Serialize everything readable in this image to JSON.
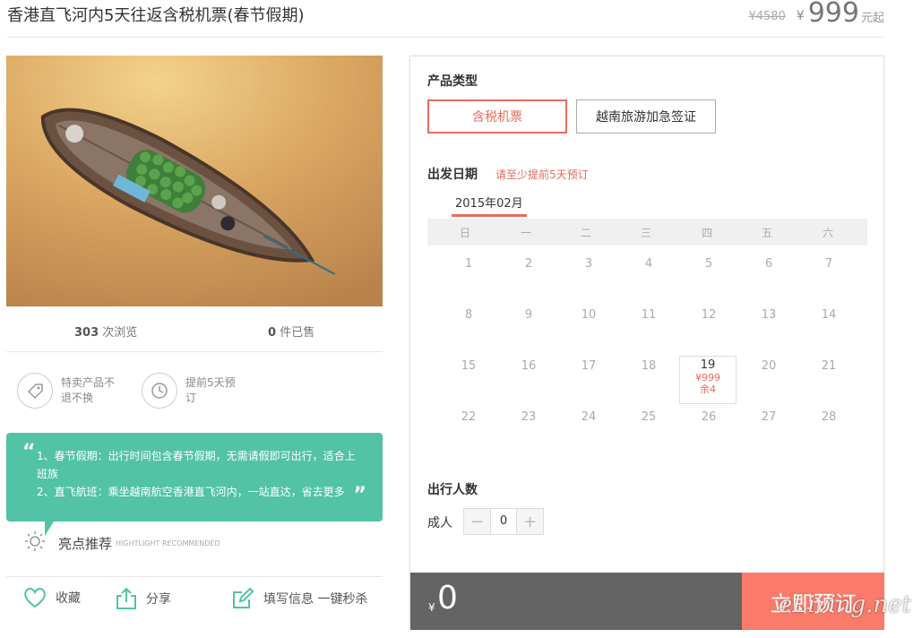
{
  "product": {
    "title": "香港直飞河内5天往返含税机票(春节假期)",
    "old_price": "¥4580",
    "currency": "¥",
    "price": "999",
    "price_unit": "元起"
  },
  "stats": {
    "views_count": "303",
    "views_label": "次浏览",
    "sold_count": "0",
    "sold_label": "件已售"
  },
  "features": [
    {
      "text": "特卖产品不退不换",
      "icon": "tag-icon"
    },
    {
      "text": "提前5天预订",
      "icon": "clock-icon"
    }
  ],
  "highlights": {
    "line1": "1、春节假期：出行时间包含春节假期，无需请假即可出行，适合上班族",
    "line2": "2、直飞航班：乘坐越南航空香港直飞河内，一站直达，省去更多",
    "title": "亮点推荐",
    "subtitle_en": "HIGHTLIGHT RECOMMENDED",
    "color": "#52c3a5"
  },
  "actions": {
    "favorite": "收藏",
    "share": "分享",
    "fill_info": "填写信息 一键秒杀"
  },
  "booking": {
    "product_type_label": "产品类型",
    "types": [
      "含税机票",
      "越南旅游加急签证"
    ],
    "date_label": "出发日期",
    "date_note": "请至少提前5天预订",
    "month": "2015年02月",
    "weekdays": [
      "日",
      "一",
      "二",
      "三",
      "四",
      "五",
      "六"
    ],
    "days": [
      "1",
      "2",
      "3",
      "4",
      "5",
      "6",
      "7",
      "8",
      "9",
      "10",
      "11",
      "12",
      "13",
      "14",
      "15",
      "16",
      "17",
      "18",
      "19",
      "20",
      "21",
      "22",
      "23",
      "24",
      "25",
      "26",
      "27",
      "28"
    ],
    "selected_day": "19",
    "selected_price": "¥999",
    "selected_stock": "余4",
    "people_label": "出行人数",
    "adult_label": "成人",
    "adult_count": "0",
    "minus": "−",
    "plus": "+",
    "total_currency": "¥",
    "total": "0",
    "book_button": "立即预订",
    "accent": "#e96b5c",
    "book_color": "#fa7b6a"
  },
  "watermark": "eLiving.net"
}
